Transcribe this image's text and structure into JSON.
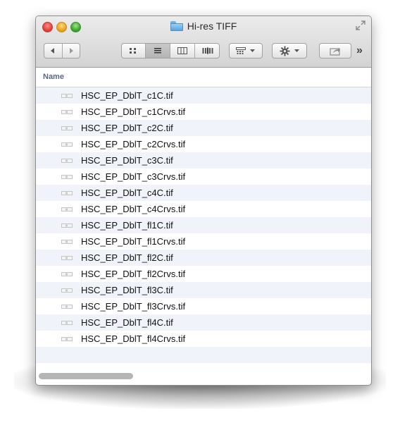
{
  "window": {
    "title": "Hi-res TIFF"
  },
  "list": {
    "header": "Name",
    "files": [
      {
        "name": "HSC_EP_DblT_c1C.tif",
        "icon": "tiff-thumbnail-icon"
      },
      {
        "name": "HSC_EP_DblT_c1Crvs.tif",
        "icon": "tiff-thumbnail-icon"
      },
      {
        "name": "HSC_EP_DblT_c2C.tif",
        "icon": "tiff-thumbnail-icon"
      },
      {
        "name": "HSC_EP_DblT_c2Crvs.tif",
        "icon": "tiff-thumbnail-icon"
      },
      {
        "name": "HSC_EP_DblT_c3C.tif",
        "icon": "tiff-thumbnail-icon"
      },
      {
        "name": "HSC_EP_DblT_c3Crvs.tif",
        "icon": "tiff-thumbnail-icon"
      },
      {
        "name": "HSC_EP_DblT_c4C.tif",
        "icon": "tiff-thumbnail-icon"
      },
      {
        "name": "HSC_EP_DblT_c4Crvs.tif",
        "icon": "tiff-thumbnail-icon"
      },
      {
        "name": "HSC_EP_DblT_fl1C.tif",
        "icon": "tiff-thumbnail-icon"
      },
      {
        "name": "HSC_EP_DblT_fl1Crvs.tif",
        "icon": "tiff-thumbnail-icon"
      },
      {
        "name": "HSC_EP_DblT_fl2C.tif",
        "icon": "tiff-thumbnail-icon"
      },
      {
        "name": "HSC_EP_DblT_fl2Crvs.tif",
        "icon": "tiff-thumbnail-icon"
      },
      {
        "name": "HSC_EP_DblT_fl3C.tif",
        "icon": "tiff-thumbnail-icon"
      },
      {
        "name": "HSC_EP_DblT_fl3Crvs.tif",
        "icon": "tiff-thumbnail-icon"
      },
      {
        "name": "HSC_EP_DblT_fl4C.tif",
        "icon": "tiff-thumbnail-icon"
      },
      {
        "name": "HSC_EP_DblT_fl4Crvs.tif",
        "icon": "tiff-thumbnail-icon"
      }
    ]
  },
  "toolbar": {
    "nav": [
      "back-icon",
      "forward-icon"
    ],
    "views": [
      "icon-view-icon",
      "list-view-icon",
      "column-view-icon",
      "cover-flow-icon"
    ],
    "active_view": "list-view-icon",
    "arrange": "arrange-icon",
    "action": "gear-icon",
    "share": "share-icon",
    "overflow": "»"
  },
  "colors": {
    "row_alt": "#f0f4fa",
    "header_text": "#5a6a80",
    "folder_blue": "#5aa3dc"
  }
}
